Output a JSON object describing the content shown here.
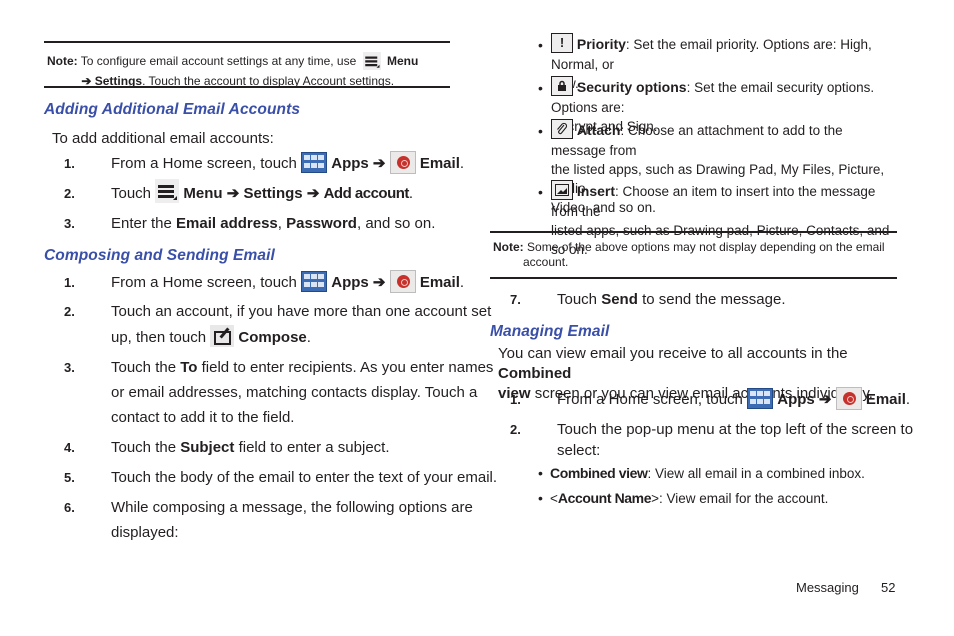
{
  "left": {
    "note": {
      "label": "Note:",
      "text_a": "To configure email account settings at any time, use",
      "menu_label": "Menu",
      "arrow": "➔",
      "settings_label": "Settings",
      "text_b": ". Touch the account to display Account settings."
    },
    "section1": {
      "heading": "Adding Additional Email Accounts",
      "intro": "To add additional email accounts:",
      "steps": [
        {
          "num": "1.",
          "pre": "From a Home screen, touch",
          "apps": "Apps",
          "arrow": "➔",
          "email": "Email",
          "post": "."
        },
        {
          "num": "2.",
          "pre": "Touch",
          "menu": "Menu",
          "arrow1": "➔",
          "settings": "Settings",
          "arrow2": "➔",
          "add": "Add account",
          "post": "."
        },
        {
          "num": "3.",
          "pre": "Enter the",
          "b1": "Email address",
          "mid": ",",
          "b2": "Password",
          "post": ", and so on."
        }
      ]
    },
    "section2": {
      "heading": "Composing and Sending Email",
      "steps": [
        {
          "num": "1.",
          "pre": "From a Home screen, touch",
          "apps": "Apps",
          "arrow": "➔",
          "email": "Email",
          "post": "."
        },
        {
          "num": "2.",
          "line1": "Touch an account, if you have more than one account set",
          "line2_pre": "up, then touch",
          "compose": "Compose",
          "post": "."
        },
        {
          "num": "3.",
          "line1_pre": "Touch the",
          "to": "To",
          "line1_post": "field to enter recipients. As you enter names",
          "line2": "or email addresses, matching contacts display. Touch a",
          "line3": "contact to add it to the field."
        },
        {
          "num": "4.",
          "pre": "Touch the",
          "b": "Subject",
          "post": "field to enter a subject."
        },
        {
          "num": "5.",
          "text": "Touch the body of the email to enter the text of your email."
        },
        {
          "num": "6.",
          "line1": "While composing a message, the following options are",
          "line2": "displayed:"
        }
      ]
    }
  },
  "right": {
    "options": [
      {
        "icon": "!",
        "label": "Priority",
        "line1": ": Set the email priority. Options are: High, Normal, or",
        "line2": "Low."
      },
      {
        "icon": "lock",
        "label": "Security options",
        "line1": ": Set the email security options. Options are:",
        "line2": "Encrypt and Sign."
      },
      {
        "icon": "paperclip",
        "label": "Attach",
        "line1": ": Choose an attachment to add to the message from",
        "line2": "the listed apps, such as Drawing Pad, My Files, Picture, Audio,",
        "line3": "Video, and so on."
      },
      {
        "icon": "image",
        "label": "Insert",
        "line1": ": Choose an item to insert into the message from the",
        "line2": "listed apps, such as Drawing pad, Picture, Contacts, and so on."
      }
    ],
    "note": {
      "label": "Note:",
      "line1": "Some of the above options may not display depending on the email",
      "line2": "account."
    },
    "step7": {
      "num": "7.",
      "pre": "Touch",
      "b": "Send",
      "post": "to send the message."
    },
    "section3": {
      "heading": "Managing Email",
      "intro_pre": "You can view email you receive to all accounts in the",
      "intro_b1": "Combined",
      "intro_b2": "view",
      "intro_post": "screen or you can view email accounts individually.",
      "steps": [
        {
          "num": "1.",
          "pre": "From a Home screen, touch",
          "apps": "Apps",
          "arrow": "➔",
          "email": "Email",
          "post": "."
        },
        {
          "num": "2.",
          "line1": "Touch the pop-up menu at the top left of the screen to",
          "line2": "select:"
        }
      ],
      "subbullets": [
        {
          "b": "Combined view",
          "text": ": View all email in a combined inbox."
        },
        {
          "pre": "<",
          "b": "Account Name",
          "text": ">: View email for the account."
        }
      ]
    }
  },
  "footer": {
    "section": "Messaging",
    "page": "52"
  }
}
